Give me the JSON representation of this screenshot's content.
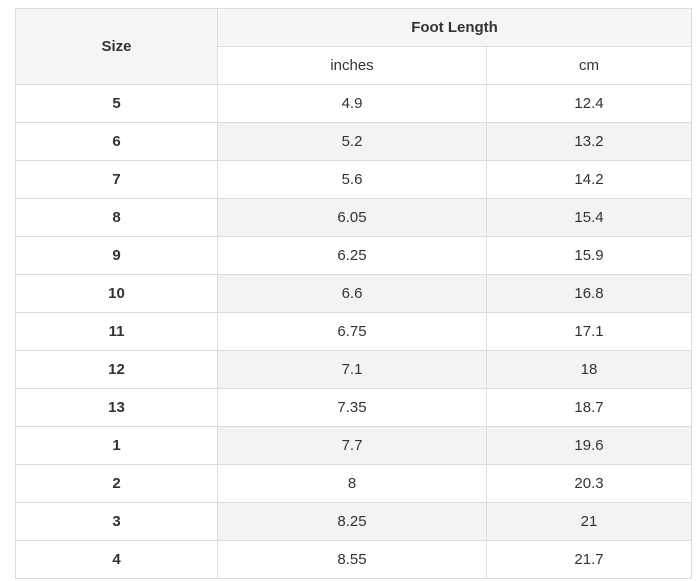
{
  "header": {
    "size_label": "Size",
    "foot_length_label": "Foot Length",
    "inches_label": "inches",
    "cm_label": "cm"
  },
  "rows": [
    {
      "size": "5",
      "inches": "4.9",
      "cm": "12.4"
    },
    {
      "size": "6",
      "inches": "5.2",
      "cm": "13.2"
    },
    {
      "size": "7",
      "inches": "5.6",
      "cm": "14.2"
    },
    {
      "size": "8",
      "inches": "6.05",
      "cm": "15.4"
    },
    {
      "size": "9",
      "inches": "6.25",
      "cm": "15.9"
    },
    {
      "size": "10",
      "inches": "6.6",
      "cm": "16.8"
    },
    {
      "size": "11",
      "inches": "6.75",
      "cm": "17.1"
    },
    {
      "size": "12",
      "inches": "7.1",
      "cm": "18"
    },
    {
      "size": "13",
      "inches": "7.35",
      "cm": "18.7"
    },
    {
      "size": "1",
      "inches": "7.7",
      "cm": "19.6"
    },
    {
      "size": "2",
      "inches": "8",
      "cm": "20.3"
    },
    {
      "size": "3",
      "inches": "8.25",
      "cm": "21"
    },
    {
      "size": "4",
      "inches": "8.55",
      "cm": "21.7"
    }
  ]
}
